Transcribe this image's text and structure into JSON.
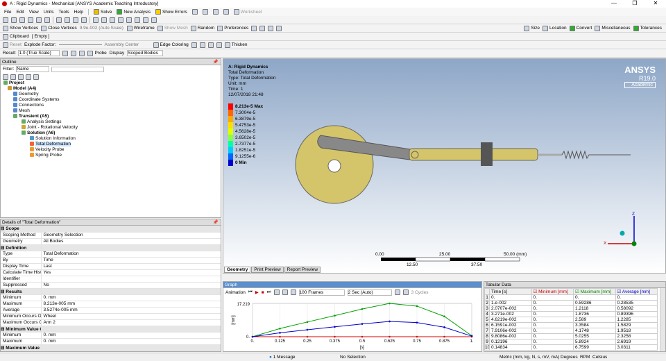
{
  "window": {
    "title": "A : Rigid Dynamics - Mechanical [ANSYS Academic Teaching Introductory]",
    "controls": [
      "—",
      "❐",
      "✕"
    ]
  },
  "menu": [
    "File",
    "Edit",
    "View",
    "Units",
    "Tools",
    "Help"
  ],
  "toolbar1": {
    "solve": "Solve",
    "new_analysis": "New Analysis",
    "show_errors": "Show Errors",
    "worksheet": "Worksheet"
  },
  "toolbar2": {
    "show_vertices": "Show Vertices",
    "close_vertices": "Close Vertices",
    "auto_scale": "9.9e-002 (Auto Scale)",
    "wireframe": "Wireframe",
    "show_mesh": "Show Mesh",
    "random": "Random",
    "preferences": "Preferences",
    "size": "Size",
    "location": "Location",
    "convert": "Convert",
    "miscellaneous": "Miscellaneous",
    "tolerances": "Tolerances"
  },
  "toolbar3": {
    "clipboard": "Clipboard",
    "empty": "[ Empty ]",
    "reset": "Reset",
    "explode_factor": "Explode Factor:",
    "assembly_center": "Assembly Center",
    "edge_coloring": "Edge Coloring",
    "thicken": "Thicken"
  },
  "toolbar4": {
    "result": "Result",
    "result_scale": "1.0 (True Scale)",
    "probe": "Probe",
    "display": "Display",
    "scoped_bodies": "Scoped Bodies"
  },
  "outline": {
    "title": "Outline",
    "filter_label": "Filter:",
    "filter_value": "Name",
    "items": [
      "Project",
      "Model (A4)",
      "Geometry",
      "Coordinate Systems",
      "Connections",
      "Mesh",
      "Transient (A5)",
      "Analysis Settings",
      "Joint - Rotational Velocity",
      "Solution (A6)",
      "Solution Information",
      "Total Deformation",
      "Velocity Probe",
      "Spring Probe"
    ]
  },
  "details": {
    "title": "Details of \"Total Deformation\"",
    "rows": [
      [
        "Scope",
        ""
      ],
      [
        "Scoping Method",
        "Geometry Selection"
      ],
      [
        "Geometry",
        "All Bodies"
      ],
      [
        "Definition",
        ""
      ],
      [
        "Type",
        "Total Deformation"
      ],
      [
        "By",
        "Time"
      ],
      [
        "Display Time",
        "Last"
      ],
      [
        "Calculate Time History",
        "Yes"
      ],
      [
        "Identifier",
        ""
      ],
      [
        "Suppressed",
        "No"
      ],
      [
        "Results",
        ""
      ],
      [
        "Minimum",
        "0. mm"
      ],
      [
        "Maximum",
        "8.213e-005 mm"
      ],
      [
        "Average",
        "3.5274e-005 mm"
      ],
      [
        "Minimum Occurs On",
        "Wheel"
      ],
      [
        "Maximum Occurs On",
        "Arm 2"
      ],
      [
        "Minimum Value Over Time",
        ""
      ],
      [
        "Minimum",
        "0. mm"
      ],
      [
        "Maximum",
        "0. mm"
      ],
      [
        "Maximum Value Over Time",
        ""
      ]
    ]
  },
  "viewport": {
    "info": [
      "A: Rigid Dynamics",
      "Total Deformation",
      "Type: Total Deformation",
      "Unit: mm",
      "Time: 1",
      "12/07/2018 21:48"
    ],
    "brand": "ANSYS",
    "version": "R19.0",
    "edition": "Academic",
    "legend": {
      "labels": [
        "8.213e-5 Max",
        "7.3004e-5",
        "6.3879e-5",
        "5.4753e-5",
        "4.5628e-5",
        "3.6502e-5",
        "2.7377e-5",
        "1.8251e-5",
        "9.1255e-6",
        "0 Min"
      ],
      "colors": [
        "#ff0000",
        "#ff6600",
        "#ffaa00",
        "#ffdd00",
        "#ddff00",
        "#88ff44",
        "#00ffaa",
        "#00ccff",
        "#0066ff",
        "#0000cc"
      ]
    },
    "scale": {
      "ticks_top": [
        "0.00",
        "25.00",
        "50.00 (mm)"
      ],
      "ticks_bottom": [
        "12.50",
        "37.50"
      ]
    },
    "axes": {
      "z": "Z",
      "x": "X"
    },
    "tabs": [
      "Geometry",
      "Print Preview",
      "Report Preview"
    ]
  },
  "graph": {
    "title": "Graph",
    "animation": "Animation",
    "frames": "100 Frames",
    "speed": "2 Sec (Auto)",
    "cycles": "3 Cycles",
    "ylabel": "[mm]",
    "xlabel": "[s]",
    "ytop": "17.219",
    "yzero": "0."
  },
  "chart_data": {
    "type": "line",
    "x": [
      0,
      0.125,
      0.25,
      0.375,
      0.5,
      0.625,
      0.75,
      0.875,
      1
    ],
    "x_tick_labels": [
      "0.",
      "0.125",
      "0.25",
      "0.375",
      "0.5",
      "0.625",
      "0.75",
      "0.875",
      "1."
    ],
    "ylim": [
      0,
      17.219
    ],
    "series": [
      {
        "name": "Minimum [mm]",
        "color": "#dd0000",
        "values": [
          0,
          0,
          0,
          0,
          0,
          0,
          0,
          0,
          0
        ]
      },
      {
        "name": "Maximum [mm]",
        "color": "#00a000",
        "values": [
          0,
          4.2,
          7.6,
          10.9,
          14.3,
          17.2,
          15.8,
          10.5,
          0.5
        ]
      },
      {
        "name": "Average [mm]",
        "color": "#0000cc",
        "values": [
          0,
          2.0,
          3.6,
          5.1,
          6.6,
          7.9,
          7.3,
          4.9,
          0.3
        ]
      }
    ]
  },
  "tabular": {
    "title": "Tabular Data",
    "columns": [
      "Time [s]",
      "Minimum [mm]",
      "Maximum [mm]",
      "Average [mm]"
    ],
    "rows": [
      [
        "1",
        "0.",
        "0.",
        "0.",
        "0."
      ],
      [
        "2",
        "1.e-002",
        "0.",
        "0.59286",
        "0.28535"
      ],
      [
        "3",
        "2.0707e-002",
        "0.",
        "1.2118",
        "0.58092"
      ],
      [
        "4",
        "3.271e-002",
        "0.",
        "1.8736",
        "0.89396"
      ],
      [
        "5",
        "4.6219e-002",
        "0.",
        "2.589",
        "1.2285"
      ],
      [
        "6",
        "6.1591e-002",
        "0.",
        "3.3584",
        "1.5829"
      ],
      [
        "7",
        "7.9106e-002",
        "0.",
        "4.1748",
        "1.9518"
      ],
      [
        "8",
        "9.8086e-002",
        "0.",
        "5.0255",
        "2.3258"
      ],
      [
        "9",
        "0.12196",
        "0.",
        "5.8924",
        "2.6919"
      ],
      [
        "10",
        "0.14834",
        "0.",
        "6.7599",
        "3.0311"
      ]
    ]
  },
  "status": {
    "messages": "1 Message",
    "selection": "No Selection",
    "units": "Metric (mm, kg, N, s, mV, mA)",
    "angle": "Degrees",
    "rpm": "RPM",
    "temp": "Celsius"
  }
}
